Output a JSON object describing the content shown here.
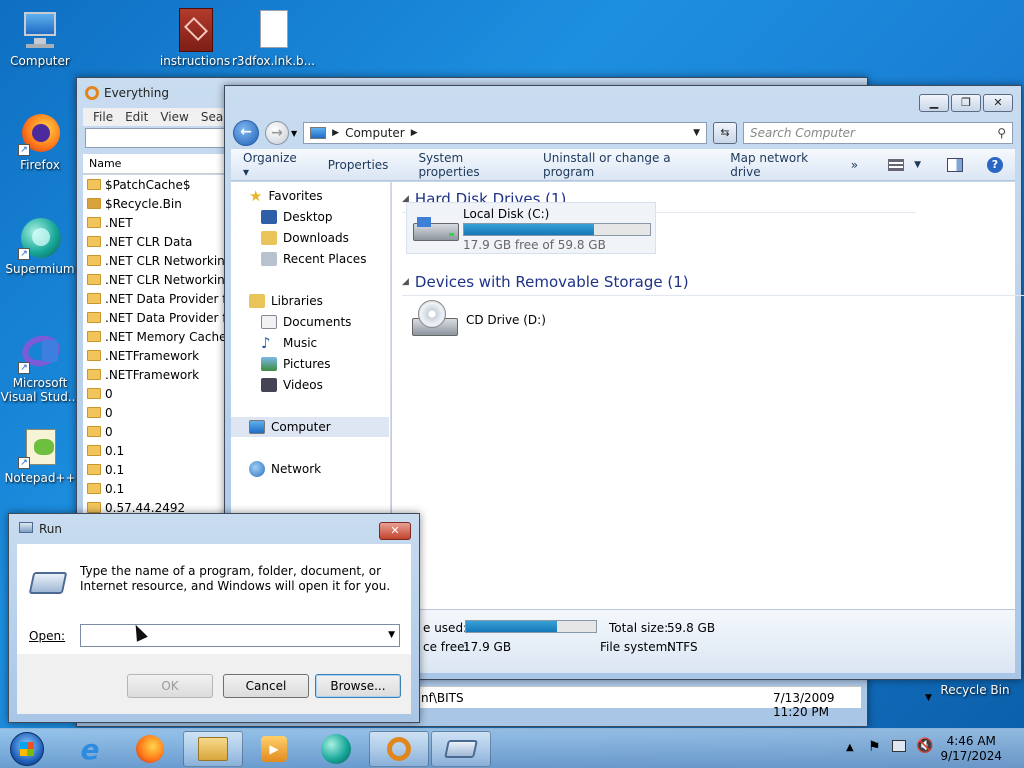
{
  "desktop": {
    "icons": [
      {
        "label": "Computer"
      },
      {
        "label": "instructions"
      },
      {
        "label": "r3dfox.lnk.b..."
      },
      {
        "label": "Firefox"
      },
      {
        "label": "Supermium"
      },
      {
        "label": "Microsoft Visual Stud..."
      },
      {
        "label": "Notepad++"
      },
      {
        "label": "Recycle Bin"
      }
    ]
  },
  "everything": {
    "title": "Everything",
    "menu": [
      "File",
      "Edit",
      "View",
      "Searc"
    ],
    "column_name": "Name",
    "files": [
      "$PatchCache$",
      "$Recycle.Bin",
      ".NET",
      ".NET CLR Data",
      ".NET CLR Networking",
      ".NET CLR Networking 4",
      ".NET Data Provider for",
      ".NET Data Provider for",
      ".NET Memory Cache 4",
      ".NETFramework",
      ".NETFramework",
      "0",
      "0",
      "0",
      "0.1",
      "0.1",
      "0.1",
      "0.57.44.2492"
    ],
    "bottom_row": {
      "name": "nf\\BITS",
      "date": "7/13/2009 11:20 PM"
    }
  },
  "explorer": {
    "address": "Computer",
    "search_placeholder": "Search Computer",
    "commands": [
      "Organize ▾",
      "Properties",
      "System properties",
      "Uninstall or change a program",
      "Map network drive",
      "»"
    ],
    "nav": {
      "favorites": "Favorites",
      "desktop": "Desktop",
      "downloads": "Downloads",
      "recent": "Recent Places",
      "libraries": "Libraries",
      "documents": "Documents",
      "music": "Music",
      "pictures": "Pictures",
      "videos": "Videos",
      "computer": "Computer",
      "network": "Network"
    },
    "groups": {
      "hdd": "Hard Disk Drives (1)",
      "removable": "Devices with Removable Storage (1)"
    },
    "local_disk": {
      "name": "Local Disk (C:)",
      "free_text": "17.9 GB free of 59.8 GB",
      "used_fraction": 0.7
    },
    "cd_drive": {
      "name": "CD Drive (D:)"
    },
    "details": {
      "space_used_label": "e used:",
      "space_free_label": "ce free:",
      "space_free": "17.9 GB",
      "total_size_label": "Total size:",
      "total_size": "59.8 GB",
      "fs_label": "File system:",
      "fs": "NTFS"
    }
  },
  "run": {
    "title": "Run",
    "description": "Type the name of a program, folder, document, or Internet resource, and Windows will open it for you.",
    "open_label": "Open:",
    "open_value": "",
    "ok": "OK",
    "cancel": "Cancel",
    "browse": "Browse..."
  },
  "taskbar": {
    "time": "4:46 AM",
    "date": "9/17/2024"
  }
}
